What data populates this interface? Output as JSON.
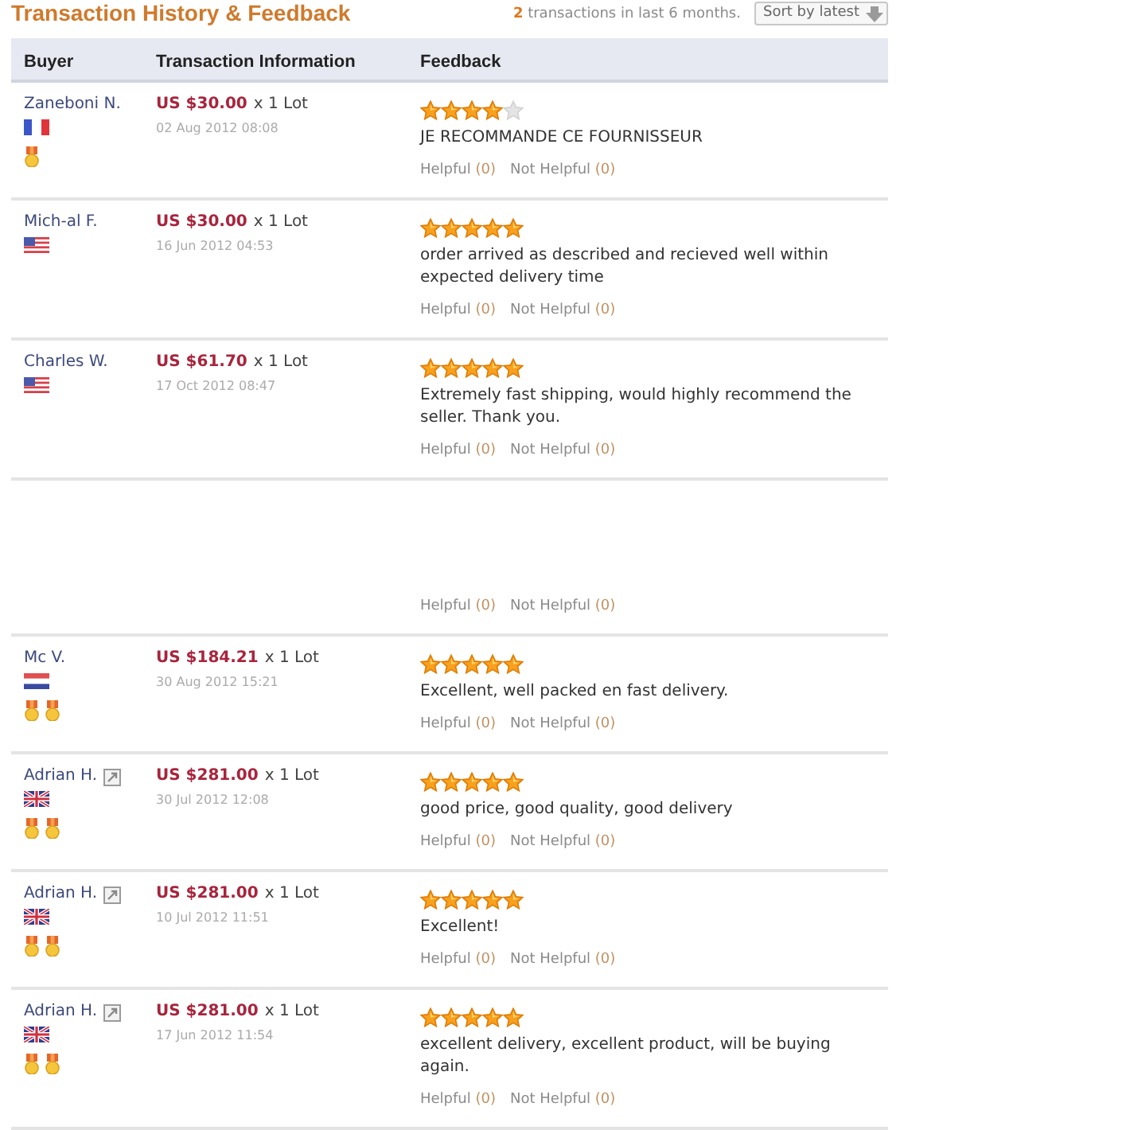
{
  "header": {
    "title": "Transaction History & Feedback",
    "summary": "**2** transactions in last 6 months.",
    "sort_button": "Sort by latest"
  },
  "table": {
    "columns": [
      "Buyer",
      "Transaction Information",
      "Feedback"
    ],
    "rows": [
      {
        "buyer": "Zaneboni N.",
        "note_icon": false,
        "flag": {
          "kind": "france"
        },
        "badges": [
          {
            "kind": "medal"
          }
        ],
        "price": "US $30.00",
        "quantity": "x 1 Lot",
        "date": "02 Aug 2012 08:08",
        "stars": 4,
        "comment": "JE RECOMMANDE CE FOURNISSEUR",
        "helpful": {
          "label": "Helpful",
          "count": "(0)"
        },
        "not_helpful": {
          "label": "Not Helpful",
          "count": "(0)"
        }
      },
      {
        "buyer": "Mich-al F.",
        "note_icon": false,
        "flag": {
          "kind": "usa"
        },
        "price": "US $30.00",
        "quantity": "x 1 Lot",
        "date": "16 Jun 2012 04:53",
        "stars": 5,
        "comment": "order arrived as described and recieved well within expected delivery time",
        "helpful": {
          "label": "Helpful",
          "count": "(0)"
        },
        "not_helpful": {
          "label": "Not Helpful",
          "count": "(0)"
        }
      },
      {
        "buyer": "Charles W.",
        "note_icon": false,
        "flag": {
          "kind": "usa"
        },
        "price": "US $61.70",
        "quantity": "x 1 Lot",
        "date": "17 Oct 2012 08:47",
        "stars": 5,
        "comment": "Extremely fast shipping, would highly recommend the seller. Thank you.",
        "helpful": {
          "label": "Helpful",
          "count": "(0)"
        },
        "not_helpful": {
          "label": "Not Helpful",
          "count": "(0)"
        }
      },
      {
        "helpful": {
          "label": "Helpful",
          "count": "(0)"
        },
        "not_helpful": {
          "label": "Not Helpful",
          "count": "(0)"
        }
      },
      {
        "buyer": "Mc V.",
        "note_icon": false,
        "flag": {
          "kind": "netherlands"
        },
        "badges": [
          {
            "kind": "medal"
          },
          {
            "kind": "medal"
          }
        ],
        "price": "US $184.21",
        "quantity": "x 1 Lot",
        "date": "30 Aug 2012 15:21",
        "stars": 5,
        "comment": "Excellent, well packed en fast delivery.",
        "helpful": {
          "label": "Helpful",
          "count": "(0)"
        },
        "not_helpful": {
          "label": "Not Helpful",
          "count": "(0)"
        }
      },
      {
        "buyer": "Adrian H.",
        "note_icon": true,
        "flag": {
          "kind": "uk"
        },
        "badges": [
          {
            "kind": "medal"
          },
          {
            "kind": "medal"
          }
        ],
        "price": "US $281.00",
        "quantity": "x 1 Lot",
        "date": "30 Jul 2012 12:08",
        "stars": 5,
        "comment": "good price, good quality, good delivery",
        "helpful": {
          "label": "Helpful",
          "count": "(0)"
        },
        "not_helpful": {
          "label": "Not Helpful",
          "count": "(0)"
        }
      },
      {
        "buyer": "Adrian H.",
        "note_icon": true,
        "flag": {
          "kind": "uk"
        },
        "badges": [
          {
            "kind": "medal"
          },
          {
            "kind": "medal"
          }
        ],
        "price": "US $281.00",
        "quantity": "x 1 Lot",
        "date": "10 Jul 2012 11:51",
        "stars": 5,
        "comment": "Excellent!",
        "helpful": {
          "label": "Helpful",
          "count": "(0)"
        },
        "not_helpful": {
          "label": "Not Helpful",
          "count": "(0)"
        }
      },
      {
        "buyer": "Adrian H.",
        "note_icon": true,
        "flag": {
          "kind": "uk"
        },
        "badges": [
          {
            "kind": "medal"
          },
          {
            "kind": "medal"
          }
        ],
        "price": "US $281.00",
        "quantity": "x 1 Lot",
        "date": "17 Jun 2012 11:54",
        "stars": 5,
        "comment": "excellent delivery, excellent product, will be buying again.",
        "helpful": {
          "label": "Helpful",
          "count": "(0)"
        },
        "not_helpful": {
          "label": "Not Helpful",
          "count": "(0)"
        }
      }
    ]
  }
}
